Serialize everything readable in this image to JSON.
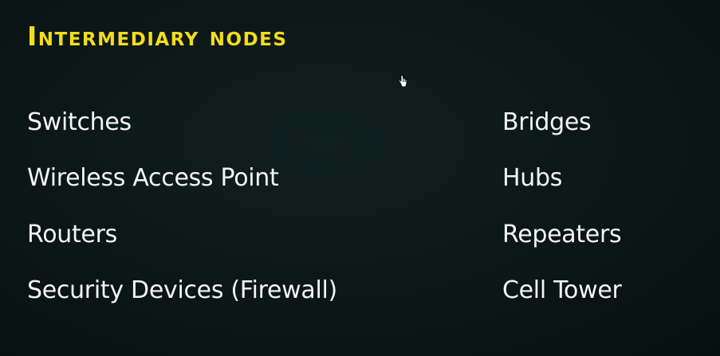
{
  "slide": {
    "title": "Intermediary nodes",
    "left_items": [
      {
        "label": "Switches"
      },
      {
        "label": "Wireless Access Point"
      },
      {
        "label": "Routers"
      },
      {
        "label": "Security Devices (Firewall)"
      }
    ],
    "right_items": [
      {
        "label": "Bridges"
      },
      {
        "label": "Hubs"
      },
      {
        "label": "Repeaters"
      },
      {
        "label": "Cell Tower"
      }
    ]
  },
  "colors": {
    "background": "#0b1616",
    "title": "#f2dc1c",
    "text": "#f4f4f4"
  },
  "cursor": {
    "icon": "hand-pointer-icon"
  }
}
